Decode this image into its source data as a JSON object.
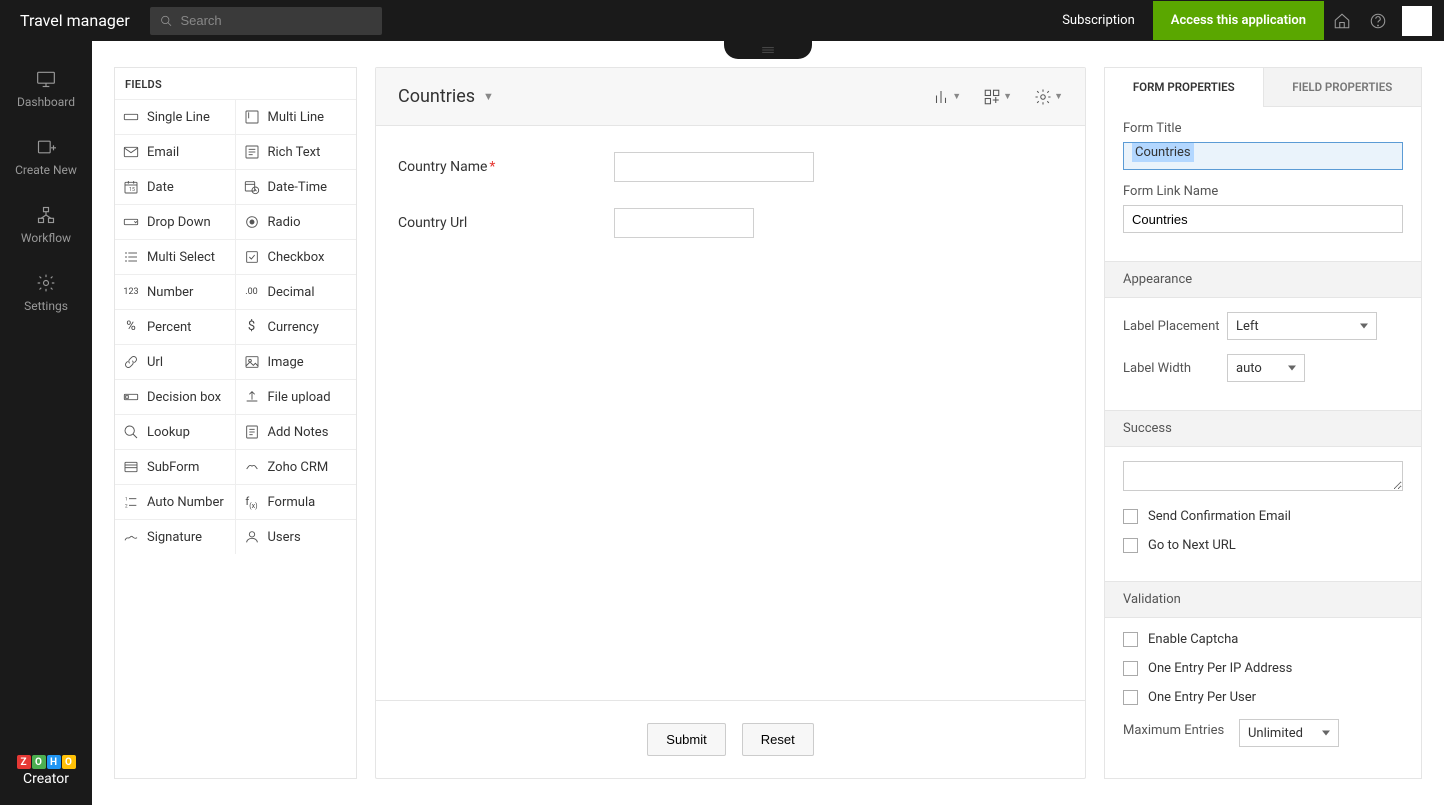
{
  "header": {
    "appTitle": "Travel manager",
    "searchPlaceholder": "Search",
    "subscription": "Subscription",
    "accessBtn": "Access this application"
  },
  "leftNav": {
    "dashboard": "Dashboard",
    "createNew": "Create New",
    "workflow": "Workflow",
    "settings": "Settings",
    "brand": "Creator",
    "brandLetters": [
      "Z",
      "O",
      "H",
      "O"
    ]
  },
  "fieldsPanel": {
    "header": "FIELDS",
    "items": [
      "Single Line",
      "Multi Line",
      "Email",
      "Rich Text",
      "Date",
      "Date-Time",
      "Drop Down",
      "Radio",
      "Multi Select",
      "Checkbox",
      "Number",
      "Decimal",
      "Percent",
      "Currency",
      "Url",
      "Image",
      "Decision box",
      "File upload",
      "Lookup",
      "Add Notes",
      "SubForm",
      "Zoho CRM",
      "Auto Number",
      "Formula",
      "Signature",
      "Users"
    ]
  },
  "canvas": {
    "title": "Countries",
    "fields": {
      "countryName": "Country Name",
      "countryUrl": "Country Url"
    },
    "submit": "Submit",
    "reset": "Reset"
  },
  "props": {
    "tabForm": "FORM PROPERTIES",
    "tabField": "FIELD PROPERTIES",
    "formTitleLabel": "Form Title",
    "formTitleValue": "Countries",
    "formLinkLabel": "Form Link Name",
    "formLinkValue": "Countries",
    "appearance": "Appearance",
    "labelPlacement": "Label Placement",
    "labelPlacementValue": "Left",
    "labelWidth": "Label Width",
    "labelWidthValue": "auto",
    "success": "Success",
    "confirmEmail": "Send Confirmation Email",
    "goNext": "Go to Next URL",
    "validation": "Validation",
    "captcha": "Enable Captcha",
    "oneIp": "One Entry Per IP Address",
    "oneUser": "One Entry Per User",
    "maxEntries": "Maximum Entries",
    "maxEntriesValue": "Unlimited"
  }
}
